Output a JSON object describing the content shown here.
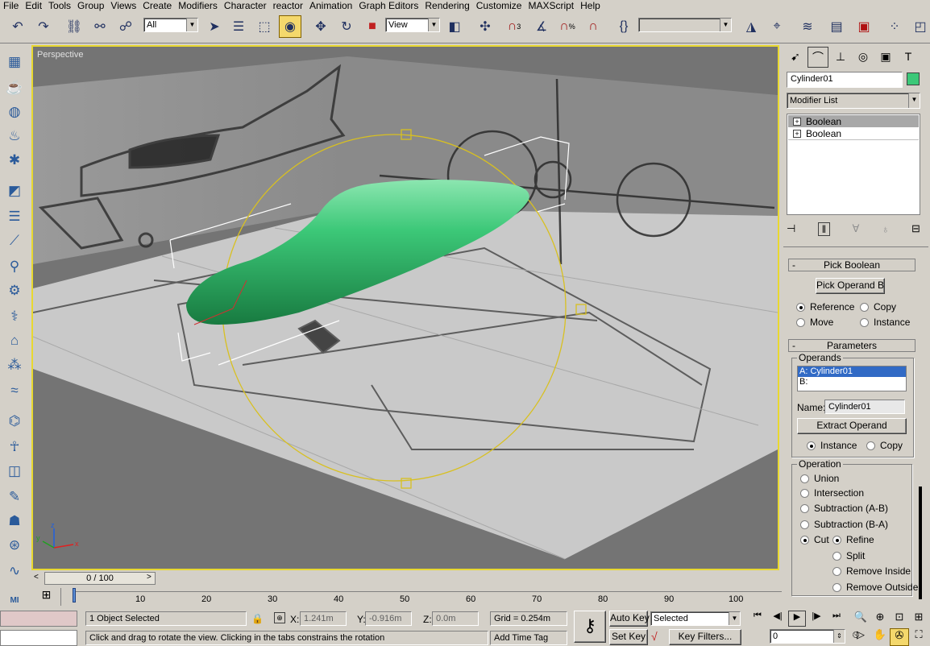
{
  "menu": [
    "File",
    "Edit",
    "Tools",
    "Group",
    "Views",
    "Create",
    "Modifiers",
    "Character",
    "reactor",
    "Animation",
    "Graph Editors",
    "Rendering",
    "Customize",
    "MAXScript",
    "Help"
  ],
  "toolbar": {
    "selection_filter": "All",
    "ref_coord": "View",
    "named_sel": "",
    "spinner_snap_label": "%",
    "angle_snap_label": "3"
  },
  "viewport": {
    "label": "Perspective",
    "axes": {
      "x": "x",
      "y": "y",
      "z": "z"
    }
  },
  "timeline": {
    "frame_display": "0 / 100",
    "ticks": [
      "10",
      "20",
      "30",
      "40",
      "50",
      "60",
      "70",
      "80",
      "90",
      "100"
    ]
  },
  "status": {
    "selection": "1 Object Selected",
    "prompt": "Click and drag to rotate the view.  Clicking in the tabs constrains the rotation",
    "x_label": "X:",
    "x_value": "1.241m",
    "y_label": "Y:",
    "y_value": "-0.916m",
    "z_label": "Z:",
    "z_value": "0.0m",
    "grid": "Grid = 0.254m",
    "add_time_tag": "Add Time Tag",
    "auto_key": "Auto Key",
    "set_key": "Set Key",
    "key_mode": "Selected",
    "key_filters": "Key Filters...",
    "current_frame": "0"
  },
  "command_panel": {
    "object_name": "Cylinder01",
    "object_color": "#3cc878",
    "modifier_list": "Modifier List",
    "stack": [
      "Boolean",
      "Boolean"
    ],
    "pick_boolean": {
      "title": "Pick Boolean",
      "pick_button": "Pick Operand B",
      "reference": "Reference",
      "copy": "Copy",
      "move": "Move",
      "instance": "Instance"
    },
    "parameters": {
      "title": "Parameters",
      "operands_group": "Operands",
      "operand_a": "A: Cylinder01",
      "operand_b": "B:",
      "name_label": "Name:",
      "name_value": "Cylinder01",
      "extract_button": "Extract Operand",
      "extract_instance": "Instance",
      "extract_copy": "Copy",
      "operation_group": "Operation",
      "ops": [
        "Union",
        "Intersection",
        "Subtraction (A-B)",
        "Subtraction (B-A)"
      ],
      "cut": "Cut",
      "cut_modes": [
        "Refine",
        "Split",
        "Remove Inside",
        "Remove Outside"
      ]
    }
  }
}
